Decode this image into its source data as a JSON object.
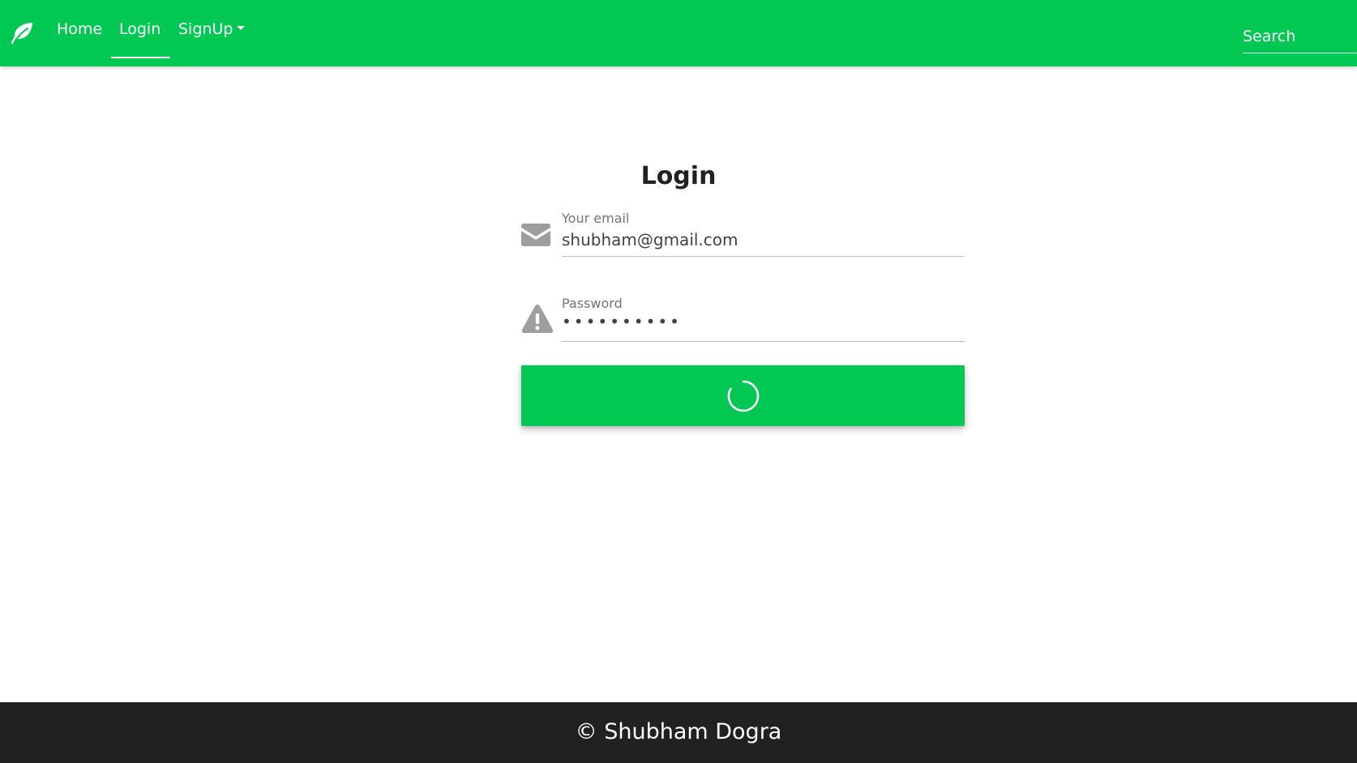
{
  "navbar": {
    "brand_icon": "leaf-icon",
    "links": [
      {
        "label": "Home"
      },
      {
        "label": "Login",
        "active": true
      },
      {
        "label": "SignUp",
        "has_dropdown": true
      }
    ],
    "search": {
      "placeholder": "Search"
    },
    "color": "#00c853"
  },
  "login": {
    "title": "Login",
    "email": {
      "label": "Your email",
      "value": "shubham@gmail.com",
      "icon": "envelope-icon"
    },
    "password": {
      "label": "Password",
      "masked_value": "••••••••••",
      "icon": "warning-icon"
    },
    "submit": {
      "state": "loading",
      "icon": "spinner-icon"
    }
  },
  "footer": {
    "text": "© Shubham Dogra"
  }
}
